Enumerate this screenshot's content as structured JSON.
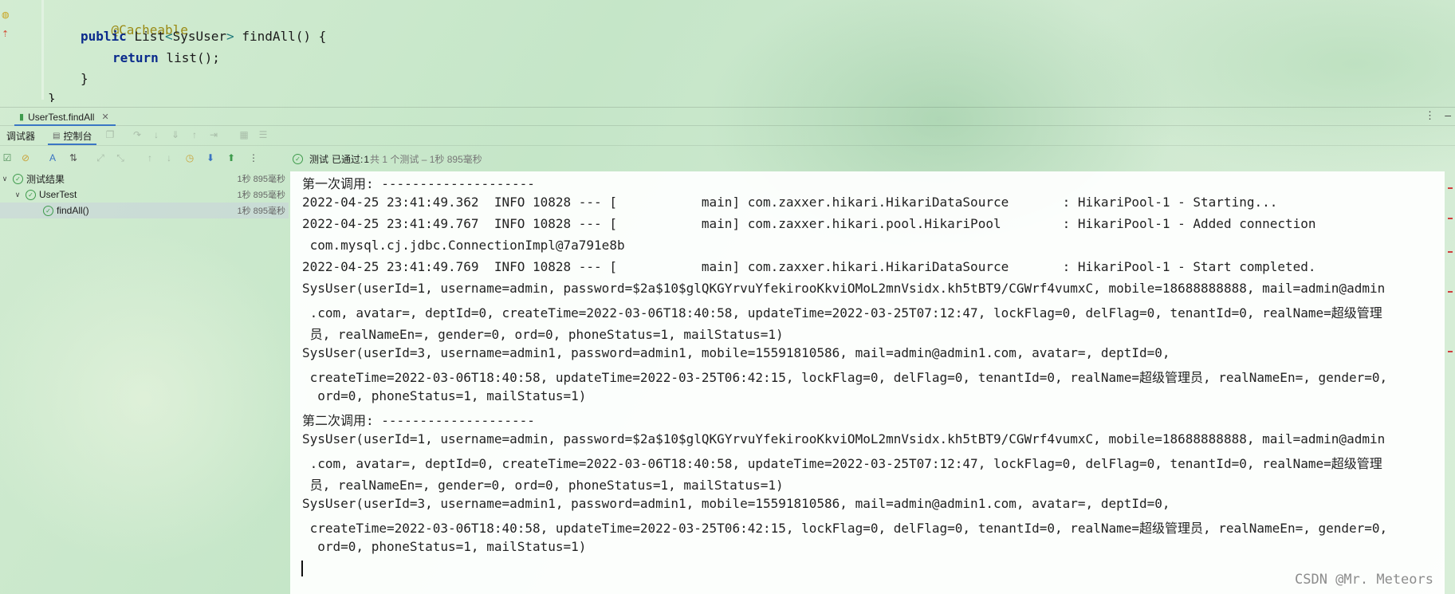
{
  "editor": {
    "lines": {
      "annotation": "@Cacheable",
      "sig_public": "public",
      "sig_type": "List",
      "sig_lt": "<",
      "sig_generic": "SysUser",
      "sig_gt": ">",
      "sig_name": " findAll() {",
      "ret_kw": "return",
      "ret_rest": " list();",
      "close_inner": "}",
      "close_outer": "}"
    }
  },
  "run_tab": {
    "label": "UserTest.findAll"
  },
  "subtabs": {
    "debugger": "调试器",
    "console": "控制台"
  },
  "status": {
    "prefix": "测试",
    "passed_label": "已通过:",
    "passed_count": "1",
    "detail": "共 1 个测试 – 1秒 895毫秒"
  },
  "tree": {
    "items": [
      {
        "label": "测试结果",
        "time": "1秒 895毫秒"
      },
      {
        "label": "UserTest",
        "time": "1秒 895毫秒"
      },
      {
        "label": "findAll()",
        "time": "1秒 895毫秒"
      }
    ]
  },
  "console": {
    "lines": [
      "第一次调用: --------------------",
      "2022-04-25 23:41:49.362  INFO 10828 --- [           main] com.zaxxer.hikari.HikariDataSource       : HikariPool-1 - Starting...",
      "2022-04-25 23:41:49.767  INFO 10828 --- [           main] com.zaxxer.hikari.pool.HikariPool        : HikariPool-1 - Added connection",
      " com.mysql.cj.jdbc.ConnectionImpl@7a791e8b",
      "2022-04-25 23:41:49.769  INFO 10828 --- [           main] com.zaxxer.hikari.HikariDataSource       : HikariPool-1 - Start completed.",
      "SysUser(userId=1, username=admin, password=$2a$10$glQKGYrvuYfekirooKkviOMoL2mnVsidx.kh5tBT9/CGWrf4vumxC, mobile=18688888888, mail=admin@admin",
      " .com, avatar=, deptId=0, createTime=2022-03-06T18:40:58, updateTime=2022-03-25T07:12:47, lockFlag=0, delFlag=0, tenantId=0, realName=超级管理",
      " 员, realNameEn=, gender=0, ord=0, phoneStatus=1, mailStatus=1)",
      "SysUser(userId=3, username=admin1, password=admin1, mobile=15591810586, mail=admin@admin1.com, avatar=, deptId=0,",
      " createTime=2022-03-06T18:40:58, updateTime=2022-03-25T06:42:15, lockFlag=0, delFlag=0, tenantId=0, realName=超级管理员, realNameEn=, gender=0,",
      "  ord=0, phoneStatus=1, mailStatus=1)",
      "第二次调用: --------------------",
      "SysUser(userId=1, username=admin, password=$2a$10$glQKGYrvuYfekirooKkviOMoL2mnVsidx.kh5tBT9/CGWrf4vumxC, mobile=18688888888, mail=admin@admin",
      " .com, avatar=, deptId=0, createTime=2022-03-06T18:40:58, updateTime=2022-03-25T07:12:47, lockFlag=0, delFlag=0, tenantId=0, realName=超级管理",
      " 员, realNameEn=, gender=0, ord=0, phoneStatus=1, mailStatus=1)",
      "SysUser(userId=3, username=admin1, password=admin1, mobile=15591810586, mail=admin@admin1.com, avatar=, deptId=0,",
      " createTime=2022-03-06T18:40:58, updateTime=2022-03-25T06:42:15, lockFlag=0, delFlag=0, tenantId=0, realName=超级管理员, realNameEn=, gender=0,",
      "  ord=0, phoneStatus=1, mailStatus=1)"
    ]
  },
  "watermark": "CSDN @Mr. Meteors",
  "icons": {
    "gutter_bean": "bean-icon",
    "gutter_override": "override-arrow-icon",
    "tab_run": "run-config-icon",
    "kebab": "more-options-icon",
    "minimize": "minimize-icon",
    "ok": "check-circle-icon"
  },
  "colors": {
    "accent": "#3a76c4",
    "pass": "#3e9b4c",
    "keyword": "#0a2a8c",
    "annotation": "#9a8a14"
  }
}
